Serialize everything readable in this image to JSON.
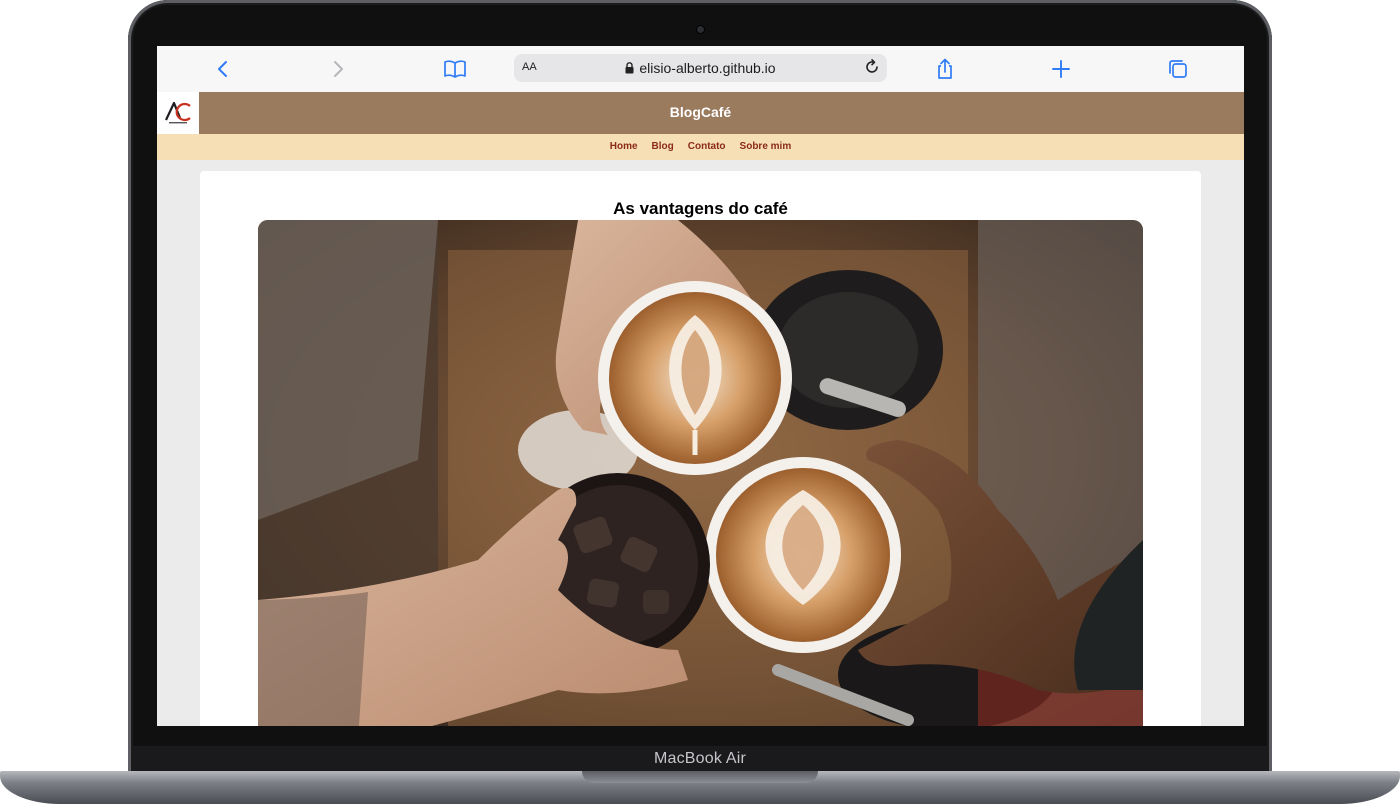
{
  "device": {
    "model_label": "MacBook Air"
  },
  "browser": {
    "text_size_label": "AA",
    "url": "elisio-alberto.github.io",
    "icons": [
      "back-icon",
      "forward-icon",
      "bookmarks-icon",
      "lock-icon",
      "reload-icon",
      "share-icon",
      "new-tab-icon",
      "tabs-icon"
    ],
    "accent_color": "#2f7cf6"
  },
  "site": {
    "title": "BlogCafé",
    "header_color": "#9a7b5e",
    "nav_color": "#f6dfb5",
    "nav_items": [
      {
        "label": "Home"
      },
      {
        "label": "Blog"
      },
      {
        "label": "Contato"
      },
      {
        "label": "Sobre mim"
      }
    ]
  },
  "post": {
    "title": "As vantagens do café",
    "image_subject": "coffee-cups-toast-photo"
  }
}
